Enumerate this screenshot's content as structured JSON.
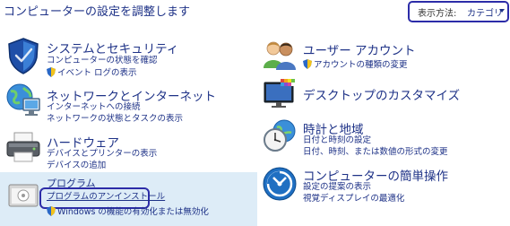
{
  "page_title": "コンピューターの設定を調整します",
  "view": {
    "label": "表示方法:",
    "value": "カテゴリ"
  },
  "categories": {
    "system": {
      "title": "システムとセキュリティ",
      "links": [
        "コンピューターの状態を確認",
        "イベント ログの表示"
      ]
    },
    "network": {
      "title": "ネットワークとインターネット",
      "links": [
        "インターネットへの接続",
        "ネットワークの状態とタスクの表示"
      ]
    },
    "hardware": {
      "title": "ハードウェア",
      "links": [
        "デバイスとプリンターの表示",
        "デバイスの追加"
      ]
    },
    "programs": {
      "title": "プログラム",
      "links": [
        "プログラムのアンインストール",
        "Windows の機能の有効化または無効化"
      ]
    },
    "user": {
      "title": "ユーザー アカウント",
      "links": [
        "アカウントの種類の変更"
      ]
    },
    "desktop": {
      "title": "デスクトップのカスタマイズ",
      "links": []
    },
    "clock": {
      "title": "時計と地域",
      "links": [
        "日付と時刻の設定",
        "日付、時刻、または数値の形式の変更"
      ]
    },
    "ease": {
      "title": "コンピューターの簡単操作",
      "links": [
        "設定の提案の表示",
        "視覚ディスプレイの最適化"
      ]
    }
  },
  "colors": {
    "link": "#1e3287",
    "highlight_border": "#2c2ca8",
    "program_panel": "#ddecf7"
  }
}
